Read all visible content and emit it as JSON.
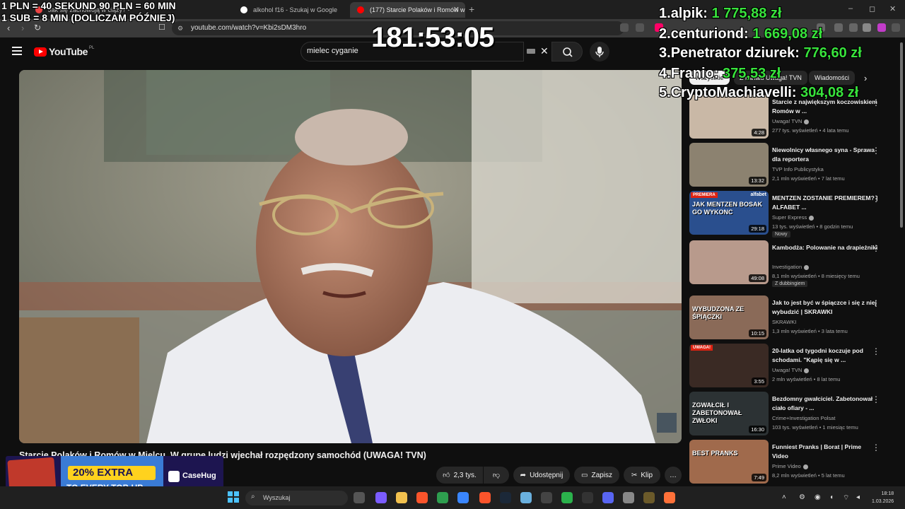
{
  "browser": {
    "tabs": [
      {
        "label": "Jak się zachowują w ciąży? -",
        "active": false
      },
      {
        "label": "alkohol f16 - Szukaj w Google",
        "active": false
      },
      {
        "label": "(177) Starcie Polaków i Romów w",
        "active": true
      }
    ],
    "new_tab": "+",
    "url": "youtube.com/watch?v=Kbi2sDM3hro",
    "window_controls": {
      "minimize": "–",
      "restore": "◻",
      "close": "✕"
    }
  },
  "youtube": {
    "logo_text": "YouTube",
    "region": "PL",
    "search": {
      "value": "mielec cyganie",
      "clear": "✕"
    },
    "chips": [
      "Wszystkie",
      "Z kanału Uwaga! TVN",
      "Wiadomości"
    ],
    "video": {
      "title": "Starcie Polaków i Romów w Mielcu. W grupe ludzi wjechał rozpędzony samochód (UWAGA! TVN)",
      "actions": {
        "like": "2,3 tys.",
        "share": "Udostępnij",
        "save": "Zapisz",
        "clip": "Klip",
        "more": "…"
      }
    },
    "related": [
      {
        "title": "Starcie z największym koczowiskiem Romów w ...",
        "channel": "Uwaga! TVN",
        "verified": true,
        "meta": "277 tys. wyświetleń • 4 lata temu",
        "duration": "4:28",
        "badge": "",
        "thumb_color": "#c9b8a6"
      },
      {
        "title": "Niewolnicy własnego syna - Sprawa dla reportera",
        "channel": "TVP Info Publicystyka",
        "verified": false,
        "meta": "2,1 mln wyświetleń • 7 lat temu",
        "duration": "13:32",
        "badge": "",
        "thumb_color": "#8c8270"
      },
      {
        "title": "MENTZEN ZOSTANIE PREMIEREM? | ALFABET ...",
        "channel": "Super Express",
        "verified": true,
        "meta": "13 tys. wyświetleń • 8 godzin temu",
        "duration": "29:18",
        "badge": "Nowy",
        "thumb_color": "#2a4f8e",
        "thumb_text": "JAK MENTZEN BOSAK GO WYKONC",
        "thumb_tag": "PREMIERA",
        "thumb_corner": "alfabet"
      },
      {
        "title": "Kambodża: Polowanie na drapieżniki",
        "channel": "Investigation",
        "verified": true,
        "meta": "8,1 mln wyświetleń • 8 miesięcy temu",
        "duration": "49:08",
        "badge": "Z dubbingiem",
        "thumb_color": "#b89a8c"
      },
      {
        "title": "Jak to jest być w śpiączce i się z niej wybudzić | SKRAWKI",
        "channel": "SKRAWKI",
        "verified": false,
        "meta": "1,3 mln wyświetleń • 3 lata temu",
        "duration": "10:15",
        "badge": "",
        "thumb_color": "#8a6a58",
        "thumb_text": "WYBUDZONA ZE ŚPIĄCZKI"
      },
      {
        "title": "20-latka od tygodni koczuje pod schodami. \"Kąpię się w ...",
        "channel": "Uwaga! TVN",
        "verified": true,
        "meta": "2 mln wyświetleń • 8 lat temu",
        "duration": "3:55",
        "badge": "",
        "thumb_color": "#3a2a24",
        "thumb_tag": "UWAGA!"
      },
      {
        "title": "Bezdomny gwałciciel. Zabetonował ciało ofiary - ...",
        "channel": "Crime+Investigation Polsat",
        "verified": false,
        "meta": "103 tys. wyświetleń • 1 miesiąc temu",
        "duration": "16:30",
        "badge": "",
        "thumb_color": "#2c3234",
        "thumb_text": "ZGWAŁCIŁ I ZABETONOWAŁ ZWŁOKI"
      },
      {
        "title": "Funniest Pranks | Borat | Prime Video",
        "channel": "Prime Video",
        "verified": true,
        "meta": "8,2 mln wyświetleń • 5 lat temu",
        "duration": "7:49",
        "badge": "",
        "thumb_color": "#a06a4c",
        "thumb_text": "BEST PRANKS"
      }
    ]
  },
  "overlay": {
    "rules": [
      "1 PLN = 40 SEKUND 90 PLN = 60 MIN",
      "1 SUB = 8 MIN (DOLICZAM PÓŹNIEJ)"
    ],
    "timer": "181:53:05",
    "leaderboard": [
      {
        "rank": "1.",
        "name": "alpik:",
        "amount": "1 775,88 zł"
      },
      {
        "rank": "2.",
        "name": "centuriond:",
        "amount": "1 669,08 zł"
      },
      {
        "rank": "3.",
        "name": "Penetrator dziurek:",
        "amount": "776,60 zł"
      },
      {
        "rank": "4.",
        "name": "Franio:",
        "amount": "375,53 zł"
      },
      {
        "rank": "5.",
        "name": "CryptoMachiavelli:",
        "amount": "304,08 zł"
      }
    ],
    "ad": {
      "headline": "20% EXTRA",
      "subline": "TO EVERY TOP-UP",
      "brand": "CaseHug"
    }
  },
  "taskbar": {
    "search_placeholder": "Wyszukaj",
    "time": "18:18",
    "date": "1.03.2026"
  },
  "colors": {
    "accent_red": "#ff0000",
    "leaderboard_amount": "#38e33c",
    "ad_yellow": "#ffd21e"
  }
}
